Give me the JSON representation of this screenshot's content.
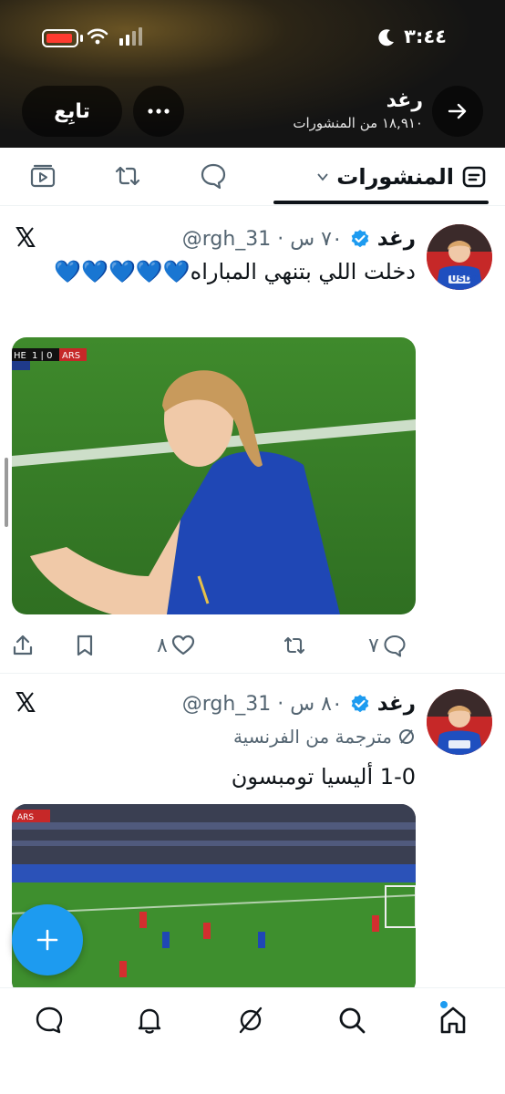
{
  "status_bar": {
    "time": "٣:٤٤"
  },
  "profile_header": {
    "name": "رغد",
    "posts_count": "١٨,٩١٠ من المنشورات",
    "follow_label": "تابِع"
  },
  "tabs": {
    "active_label": "المنشورات"
  },
  "posts": [
    {
      "name": "رغد",
      "handle_time": "@rgh_31 · ٧٠ س",
      "text": "دخلت اللي بتنهي المباراه💙💙💙💙💙",
      "scoreboard": {
        "home": "HE",
        "score": "1 | 0",
        "away": "ARS"
      },
      "replies": "٧",
      "likes": "٨"
    },
    {
      "name": "رغد",
      "handle_time": "@rgh_31 · ٨٠ س",
      "translated_label": "مترجمة من الفرنسية",
      "text": "1-0 أليسيا تومبسون",
      "scoreboard": {
        "away": "ARS"
      }
    }
  ],
  "avatar_badge": "USDC",
  "colors": {
    "accent": "#1d9bf0",
    "text": "#0f1419",
    "muted": "#536471"
  }
}
